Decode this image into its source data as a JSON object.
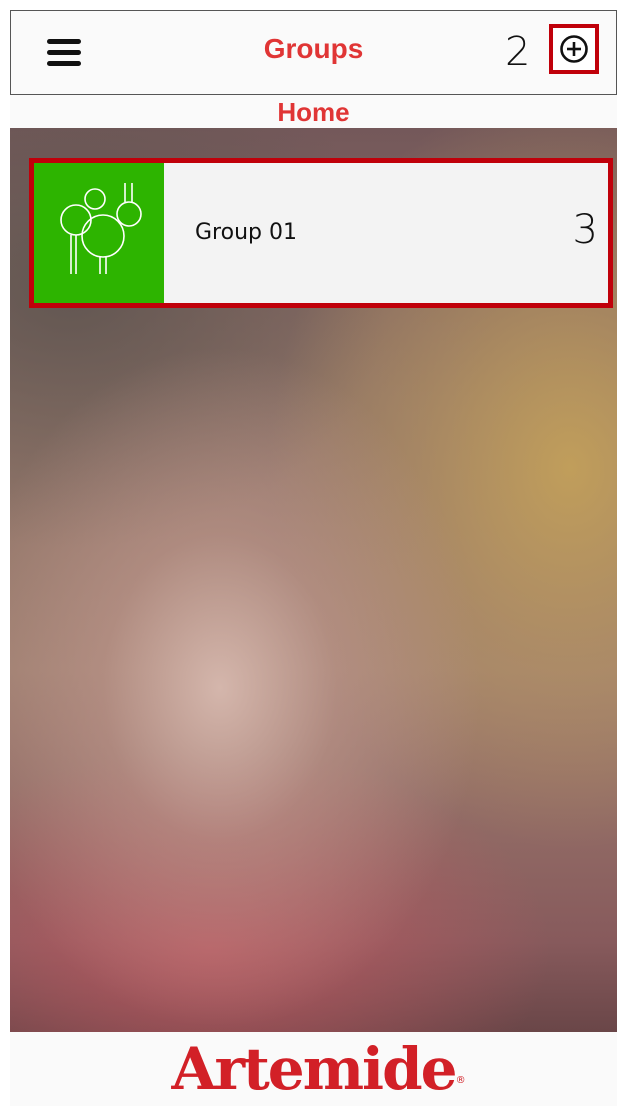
{
  "header": {
    "title": "Groups",
    "menu_icon": "hamburger-menu-icon",
    "add_icon": "plus-circle-icon",
    "annotation": "2"
  },
  "subtitle": "Home",
  "groups": [
    {
      "name": "Group 01",
      "icon": "trees-icon",
      "color": "#2db400",
      "annotation": "3"
    }
  ],
  "footer": {
    "brand": "Artemide"
  },
  "colors": {
    "accent": "#e03535",
    "highlight_border": "#c0000a",
    "group_tile": "#2db400"
  }
}
